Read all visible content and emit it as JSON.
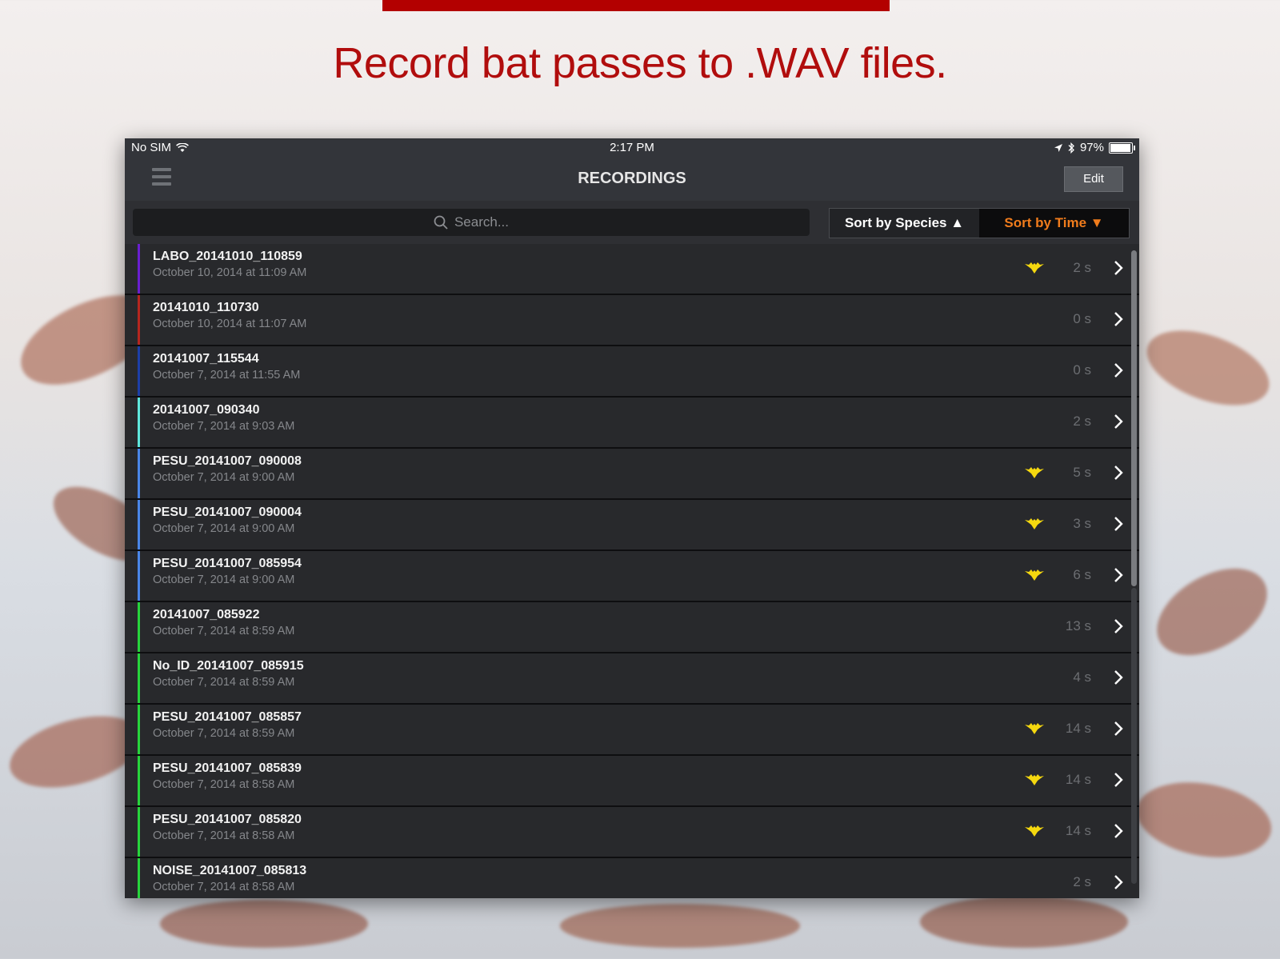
{
  "headline": "Record bat passes to .WAV files.",
  "status": {
    "carrier": "No SIM",
    "time": "2:17 PM",
    "battery": "97%",
    "battery_level": 0.97
  },
  "nav": {
    "title": "RECORDINGS",
    "edit": "Edit"
  },
  "search": {
    "placeholder": "Search..."
  },
  "sort": {
    "species": "Sort by Species ▲",
    "time": "Sort by Time ▼"
  },
  "recordings": [
    {
      "name": "LABO_20141010_110859",
      "date": "October 10, 2014 at 11:09 AM",
      "duration": "2 s",
      "bat": true,
      "color": "#6a1fd1"
    },
    {
      "name": "20141010_110730",
      "date": "October 10, 2014 at 11:07 AM",
      "duration": "0 s",
      "bat": false,
      "color": "#b5261f"
    },
    {
      "name": "20141007_115544",
      "date": "October 7, 2014 at 11:55 AM",
      "duration": "0 s",
      "bat": false,
      "color": "#1d3fa8"
    },
    {
      "name": "20141007_090340",
      "date": "October 7, 2014 at 9:03 AM",
      "duration": "2 s",
      "bat": false,
      "color": "#5fe6dc"
    },
    {
      "name": "PESU_20141007_090008",
      "date": "October 7, 2014 at 9:00 AM",
      "duration": "5 s",
      "bat": true,
      "color": "#4a86e8"
    },
    {
      "name": "PESU_20141007_090004",
      "date": "October 7, 2014 at 9:00 AM",
      "duration": "3 s",
      "bat": true,
      "color": "#4a86e8"
    },
    {
      "name": "PESU_20141007_085954",
      "date": "October 7, 2014 at 9:00 AM",
      "duration": "6 s",
      "bat": true,
      "color": "#4a86e8"
    },
    {
      "name": "20141007_085922",
      "date": "October 7, 2014 at 8:59 AM",
      "duration": "13 s",
      "bat": false,
      "color": "#27d43c"
    },
    {
      "name": "No_ID_20141007_085915",
      "date": "October 7, 2014 at 8:59 AM",
      "duration": "4 s",
      "bat": false,
      "color": "#27d43c"
    },
    {
      "name": "PESU_20141007_085857",
      "date": "October 7, 2014 at 8:59 AM",
      "duration": "14 s",
      "bat": true,
      "color": "#27d43c"
    },
    {
      "name": "PESU_20141007_085839",
      "date": "October 7, 2014 at 8:58 AM",
      "duration": "14 s",
      "bat": true,
      "color": "#27d43c"
    },
    {
      "name": "PESU_20141007_085820",
      "date": "October 7, 2014 at 8:58 AM",
      "duration": "14 s",
      "bat": true,
      "color": "#27d43c"
    },
    {
      "name": "NOISE_20141007_085813",
      "date": "October 7, 2014 at 8:58 AM",
      "duration": "2 s",
      "bat": false,
      "color": "#27d43c"
    }
  ],
  "icons": {
    "bat": "bat-icon",
    "chevron": "chevron-right-icon",
    "search": "search-icon",
    "menu": "menu-icon"
  },
  "colors": {
    "accent_red": "#b10d0d",
    "sort_time": "#f07c1c",
    "bat_yellow": "#f5d80f"
  }
}
